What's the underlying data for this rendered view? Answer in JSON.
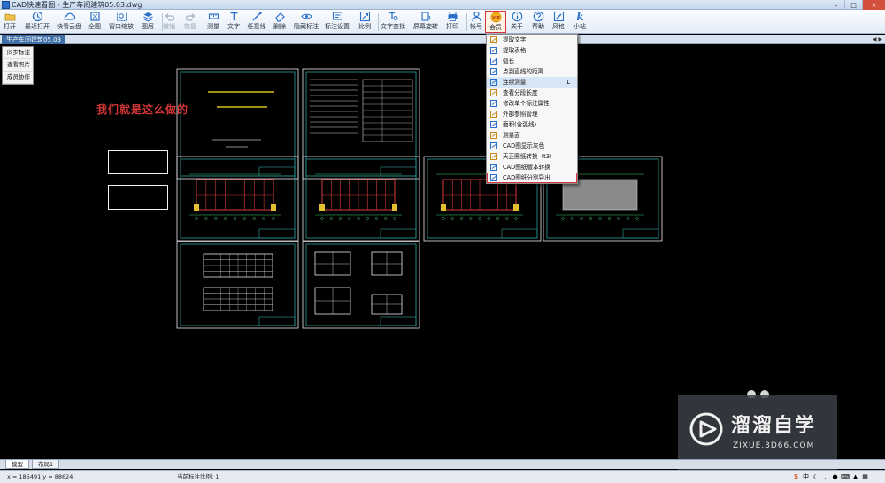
{
  "window": {
    "title": "CAD快速看图 - 生产车间建筑05.03.dwg"
  },
  "toolbar": {
    "buttons": [
      {
        "label": "打开",
        "icon": "folder-open-icon"
      },
      {
        "label": "最近打开",
        "icon": "clock-icon"
      },
      {
        "label": "快看云盘",
        "icon": "cloud-icon"
      },
      {
        "label": "全图",
        "icon": "fullview-icon"
      },
      {
        "label": "窗口缩放",
        "icon": "zoom-window-icon"
      },
      {
        "label": "图层",
        "icon": "layers-icon"
      },
      {
        "label": "撤销",
        "icon": "undo-icon"
      },
      {
        "label": "恢复",
        "icon": "redo-icon"
      },
      {
        "label": "测量",
        "icon": "measure-icon"
      },
      {
        "label": "文字",
        "icon": "text-icon"
      },
      {
        "label": "任意线",
        "icon": "freeline-icon"
      },
      {
        "label": "删除",
        "icon": "eraser-icon"
      },
      {
        "label": "隐藏标注",
        "icon": "eye-icon"
      },
      {
        "label": "标注设置",
        "icon": "annotation-settings-icon"
      },
      {
        "label": "比例",
        "icon": "scale-icon"
      },
      {
        "label": "文字查找",
        "icon": "text-search-icon"
      },
      {
        "label": "屏幕旋转",
        "icon": "rotate-icon"
      },
      {
        "label": "打印",
        "icon": "printer-icon"
      },
      {
        "label": "帐号",
        "icon": "user-icon"
      },
      {
        "label": "会员",
        "icon": "vip-icon",
        "badge": "VIP"
      },
      {
        "label": "关于",
        "icon": "info-icon"
      },
      {
        "label": "帮助",
        "icon": "help-icon"
      },
      {
        "label": "风格",
        "icon": "style-icon"
      },
      {
        "label": "小站",
        "icon": "k-site-icon",
        "glyph": "k"
      }
    ]
  },
  "tabs": {
    "active_document": "生产车间建筑05.03"
  },
  "side_menu": {
    "items": [
      "同步标注",
      "查看照片",
      "成员协作"
    ]
  },
  "canvas": {
    "caption": "我们就是这么做的",
    "caption_color": "#d43535",
    "background": "#000000"
  },
  "dropdown": {
    "items": [
      {
        "label": "提取文字",
        "icon": "extract-text-icon"
      },
      {
        "label": "提取表格",
        "icon": "extract-table-icon"
      },
      {
        "label": "弧长",
        "icon": "arc-length-icon"
      },
      {
        "label": "点到直线的距离",
        "icon": "point-line-distance-icon"
      },
      {
        "label": "连续测量",
        "icon": "continuous-measure-icon",
        "shortcut": "L",
        "highlighted": true
      },
      {
        "label": "查看分段长度",
        "icon": "segment-length-icon"
      },
      {
        "label": "修改单个标注属性",
        "icon": "edit-annotation-icon"
      },
      {
        "label": "外部参照管理",
        "icon": "xref-icon"
      },
      {
        "label": "面积(含弧线)",
        "icon": "area-icon"
      },
      {
        "label": "测量面",
        "icon": "measure-face-icon"
      },
      {
        "label": "CAD图显示灰色",
        "icon": "gray-display-icon"
      },
      {
        "label": "天正图纸转换（t3）",
        "icon": "tangent-convert-icon"
      },
      {
        "label": "CAD图纸版本转换",
        "icon": "version-convert-icon"
      },
      {
        "label": "CAD图纸分割导出",
        "icon": "split-export-icon",
        "boxed": true
      }
    ]
  },
  "layout_tabs": [
    "模型",
    "布局1"
  ],
  "status": {
    "coords": "x = 185491  y = 88624",
    "scale": "当前标注比例: 1"
  },
  "watermark": {
    "title": "溜溜自学",
    "url": "ZIXUE.3D66.COM"
  },
  "colors": {
    "accent_red": "#d8323a",
    "frame_cyan": "#2e9e9e",
    "toolbar_blue": "#2a6fc9"
  }
}
